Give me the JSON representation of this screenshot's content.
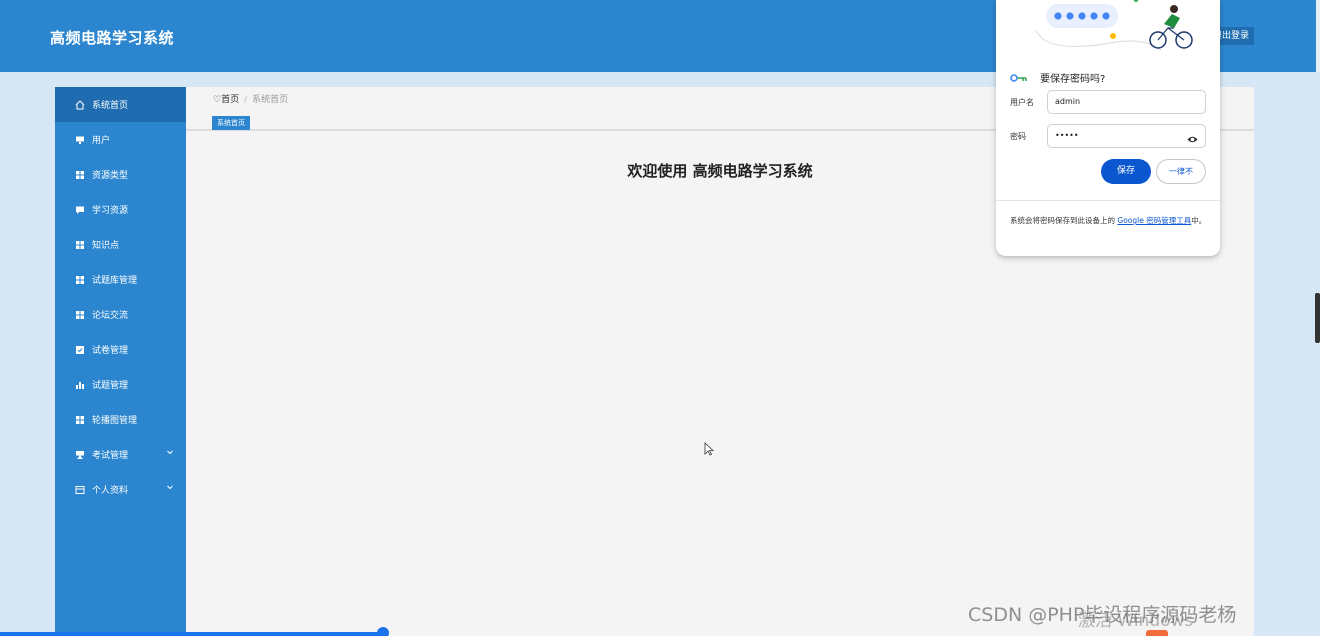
{
  "header": {
    "system_title": "高频电路学习系统",
    "logout_label": "退出登录"
  },
  "sidebar": {
    "items": [
      {
        "label": "系统首页",
        "icon": "home-icon",
        "active": true
      },
      {
        "label": "用户",
        "icon": "monitor-icon"
      },
      {
        "label": "资源类型",
        "icon": "grid-icon"
      },
      {
        "label": "学习资源",
        "icon": "chat-icon"
      },
      {
        "label": "知识点",
        "icon": "grid-icon"
      },
      {
        "label": "试题库管理",
        "icon": "grid-icon"
      },
      {
        "label": "论坛交流",
        "icon": "grid-icon"
      },
      {
        "label": "试卷管理",
        "icon": "checkbox-icon"
      },
      {
        "label": "试题管理",
        "icon": "bar-chart-icon"
      },
      {
        "label": "轮播图管理",
        "icon": "grid-icon"
      },
      {
        "label": "考试管理",
        "icon": "cup-icon",
        "expandable": true
      },
      {
        "label": "个人资料",
        "icon": "card-icon",
        "expandable": true
      }
    ]
  },
  "breadcrumb": {
    "home": "首页",
    "separator": "/",
    "current": "系统首页"
  },
  "tab": {
    "label": "系统首页"
  },
  "main": {
    "welcome": "欢迎使用 高频电路学习系统"
  },
  "password_popup": {
    "title": "要保存密码吗?",
    "username_label": "用户名",
    "username_value": "admin",
    "password_label": "密码",
    "password_value": "•••••",
    "save_label": "保存",
    "never_label": "一律不",
    "footnote_prefix": "系统会将密码保存到此设备上的",
    "footnote_link": "Google 密码管理工具",
    "footnote_suffix": "中。"
  },
  "watermark": {
    "csdn": "CSDN @PHP毕设程序源码老杨",
    "windows": "激活 Windows"
  },
  "colors": {
    "primary": "#2b86cf",
    "primary_dark": "#1f6db0",
    "page_bg": "#d7e7f5",
    "google_blue": "#0b57d0"
  }
}
